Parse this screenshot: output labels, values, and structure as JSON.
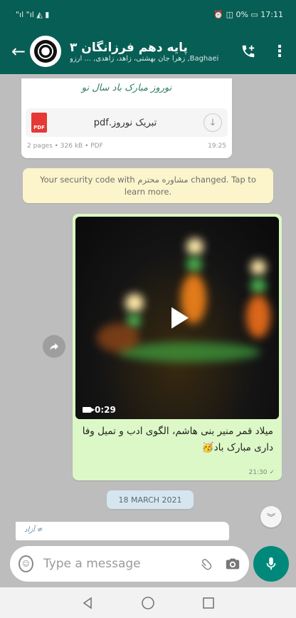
{
  "status_bar": {
    "left_icons": "\"ıl \"ıl ◭ ▮",
    "right_text": "⏰ ◫ 0% ▭ 17:11"
  },
  "header": {
    "title": "پایه دهم فرزانگان ۳",
    "subtitle": "Baghaei, زهرا جان بهشتی، زاهد، زاهدی, ... آرزو"
  },
  "doc_message": {
    "preview_text": "نوروز مبارک باد سال نو",
    "file_name": "تبریک نوروز.pdf",
    "pdf_label": "PDF",
    "meta": "2 pages • 326 kB • PDF",
    "time": "19:25"
  },
  "security_notice": {
    "text": "Your security code with مشاوره محترم changed. Tap to learn more."
  },
  "video_message": {
    "duration": "0:29",
    "caption": "میلاد قمر منیر بنی هاشم، الگوی ادب و تمیل وفا داری مبارک باد🥳",
    "time": "21:30",
    "ticks": "✓"
  },
  "date_chip": "18 MARCH 2021",
  "partial_message": {
    "text": "آزاد ≠"
  },
  "input": {
    "placeholder": "Type a message"
  },
  "colors": {
    "header_bg": "#075e54",
    "chat_bg": "#bdbdbd",
    "outgoing_bubble": "#dcf8c6",
    "notice_bg": "#fcf4cb",
    "mic_button": "#00897b"
  }
}
